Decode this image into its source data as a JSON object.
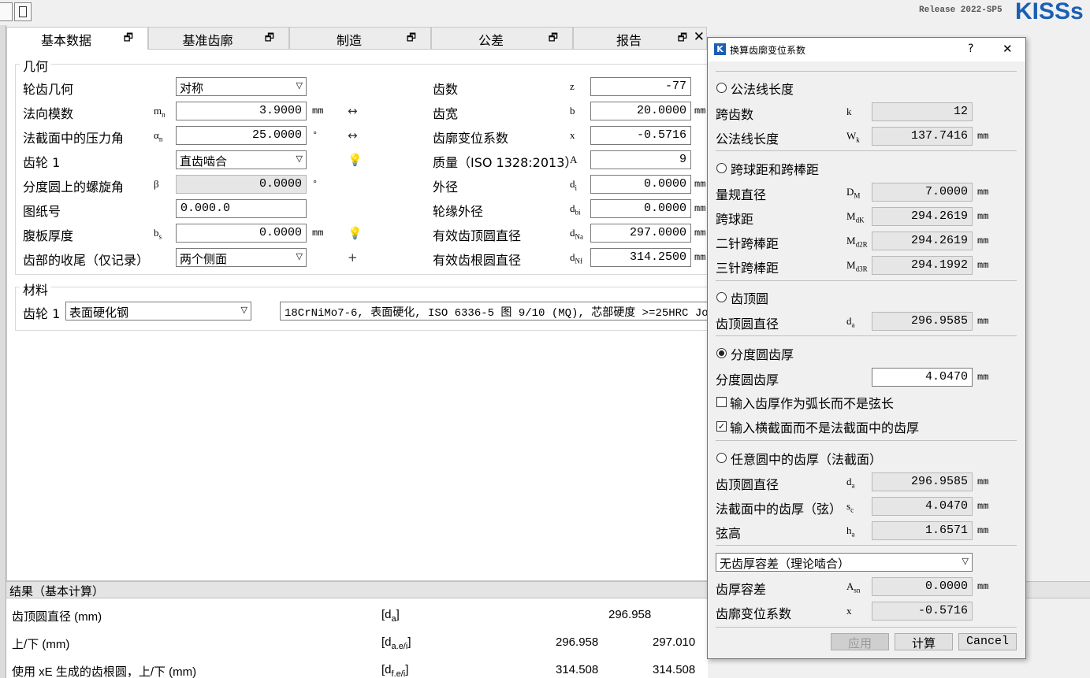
{
  "header": {
    "release": "Release 2022-SP5",
    "logo": "KISSs"
  },
  "tabs": [
    {
      "label": "基本数据",
      "icon": "restore-icon"
    },
    {
      "label": "基准齿廓",
      "icon": "restore-icon"
    },
    {
      "label": "制造",
      "icon": "restore-icon"
    },
    {
      "label": "公差",
      "icon": "restore-icon"
    },
    {
      "label": "报告",
      "icon": "restore-icon",
      "close": "✕"
    }
  ],
  "geometry": {
    "title": "几何",
    "left": [
      {
        "label": "轮齿几何",
        "type": "select",
        "value": "对称"
      },
      {
        "label": "法向模数",
        "sym": "m",
        "sub": "n",
        "value": "3.9000",
        "unit": "mm",
        "icon": "↔"
      },
      {
        "label": "法截面中的压力角",
        "sym": "α",
        "sub": "n",
        "value": "25.0000",
        "unit": "°",
        "icon": "↔"
      },
      {
        "label": "齿轮 1",
        "type": "select",
        "value": "直齿啮合",
        "icon": "💡"
      },
      {
        "label": "分度圆上的螺旋角",
        "sym": "β",
        "sub": "",
        "value": "0.0000",
        "unit": "°",
        "readonly": true
      },
      {
        "label": "图纸号",
        "type": "text",
        "value": "0.000.0"
      },
      {
        "label": "腹板厚度",
        "sym": "b",
        "sub": "s",
        "value": "0.0000",
        "unit": "mm",
        "icon": "💡"
      },
      {
        "label": "齿部的收尾（仅记录）",
        "type": "select",
        "value": "两个侧面",
        "icon": "+"
      }
    ],
    "right": [
      {
        "label": "齿数",
        "sym": "z",
        "sub": "",
        "value": "-77"
      },
      {
        "label": "齿宽",
        "sym": "b",
        "sub": "",
        "value": "20.0000",
        "unit": "mm"
      },
      {
        "label": "齿廓变位系数",
        "sym": "x",
        "sub": "",
        "value": "-0.5716"
      },
      {
        "label": "质量（ISO 1328:2013）",
        "sym": "A",
        "sub": "",
        "value": "9"
      },
      {
        "label": "外径",
        "sym": "d",
        "sub": "i",
        "value": "0.0000",
        "unit": "mm"
      },
      {
        "label": "轮缘外径",
        "sym": "d",
        "sub": "bi",
        "value": "0.0000",
        "unit": "mm"
      },
      {
        "label": "有效齿顶圆直径",
        "sym": "d",
        "sub": "Na",
        "value": "297.0000",
        "unit": "mm"
      },
      {
        "label": "有效齿根圆直径",
        "sym": "d",
        "sub": "Nf",
        "value": "314.2500",
        "unit": "mm"
      }
    ]
  },
  "material": {
    "title": "材料",
    "gear_label": "齿轮 1",
    "type_value": "表面硬化钢",
    "desc": "18CrNiMo7-6, 表面硬化, ISO 6336-5 图 9/10 (MQ), 芯部硬度 >=25HRC Jo"
  },
  "results": {
    "title": "结果（基本计算）",
    "rows": [
      {
        "label": "齿顶圆直径 (mm)",
        "sym": "d",
        "sub": "a",
        "v1": "296.958",
        "v2": ""
      },
      {
        "label": "上/下 (mm)",
        "sym": "d",
        "sub": "a.e/i",
        "v1": "296.958",
        "v2": "297.010"
      },
      {
        "label": "使用 xE 生成的齿根圆，上/下 (mm)",
        "sym": "d",
        "sub": "f.e/i",
        "v1": "314.508",
        "v2": "314.508"
      }
    ]
  },
  "dialog": {
    "title": "换算齿廓变位系数",
    "help": "?",
    "close": "✕",
    "sections": {
      "s1": {
        "radio": "公法线长度",
        "rows": [
          {
            "label": "跨齿数",
            "sym": "k",
            "sub": "",
            "value": "12",
            "unit": ""
          },
          {
            "label": "公法线长度",
            "sym": "W",
            "sub": "k",
            "value": "137.7416",
            "unit": "mm"
          }
        ]
      },
      "s2": {
        "radio": "跨球距和跨棒距",
        "rows": [
          {
            "label": "量规直径",
            "sym": "D",
            "sub": "M",
            "value": "7.0000",
            "unit": "mm"
          },
          {
            "label": "跨球距",
            "sym": "M",
            "sub": "dK",
            "value": "294.2619",
            "unit": "mm"
          },
          {
            "label": "二针跨棒距",
            "sym": "M",
            "sub": "d2R",
            "value": "294.2619",
            "unit": "mm"
          },
          {
            "label": "三针跨棒距",
            "sym": "M",
            "sub": "d3R",
            "value": "294.1992",
            "unit": "mm"
          }
        ]
      },
      "s3": {
        "radio": "齿顶圆",
        "rows": [
          {
            "label": "齿顶圆直径",
            "sym": "d",
            "sub": "a",
            "value": "296.9585",
            "unit": "mm"
          }
        ]
      },
      "s4": {
        "radio": "分度圆齿厚",
        "rows": [
          {
            "label": "分度圆齿厚",
            "sym": "",
            "sub": "",
            "value": "4.0470",
            "unit": "mm"
          }
        ],
        "chk1": "输入齿厚作为弧长而不是弦长",
        "chk2": "输入横截面而不是法截面中的齿厚",
        "chk2_mark": "✓"
      },
      "s5": {
        "radio": "任意圆中的齿厚（法截面）",
        "rows": [
          {
            "label": "齿顶圆直径",
            "sym": "d",
            "sub": "a",
            "value": "296.9585",
            "unit": "mm"
          },
          {
            "label": "法截面中的齿厚（弦）",
            "sym": "s",
            "sub": "c",
            "value": "4.0470",
            "unit": "mm"
          },
          {
            "label": "弦高",
            "sym": "h",
            "sub": "a",
            "value": "1.6571",
            "unit": "mm"
          }
        ]
      }
    },
    "tolerance_select": "无齿厚容差（理论啮合）",
    "tol_rows": [
      {
        "label": "齿厚容差",
        "sym": "A",
        "sub": "sn",
        "value": "0.0000",
        "unit": "mm"
      },
      {
        "label": "齿廓变位系数",
        "sym": "x",
        "sub": "",
        "value": "-0.5716",
        "unit": ""
      }
    ],
    "buttons": {
      "apply": "应用",
      "calc": "计算",
      "cancel": "Cancel"
    }
  }
}
